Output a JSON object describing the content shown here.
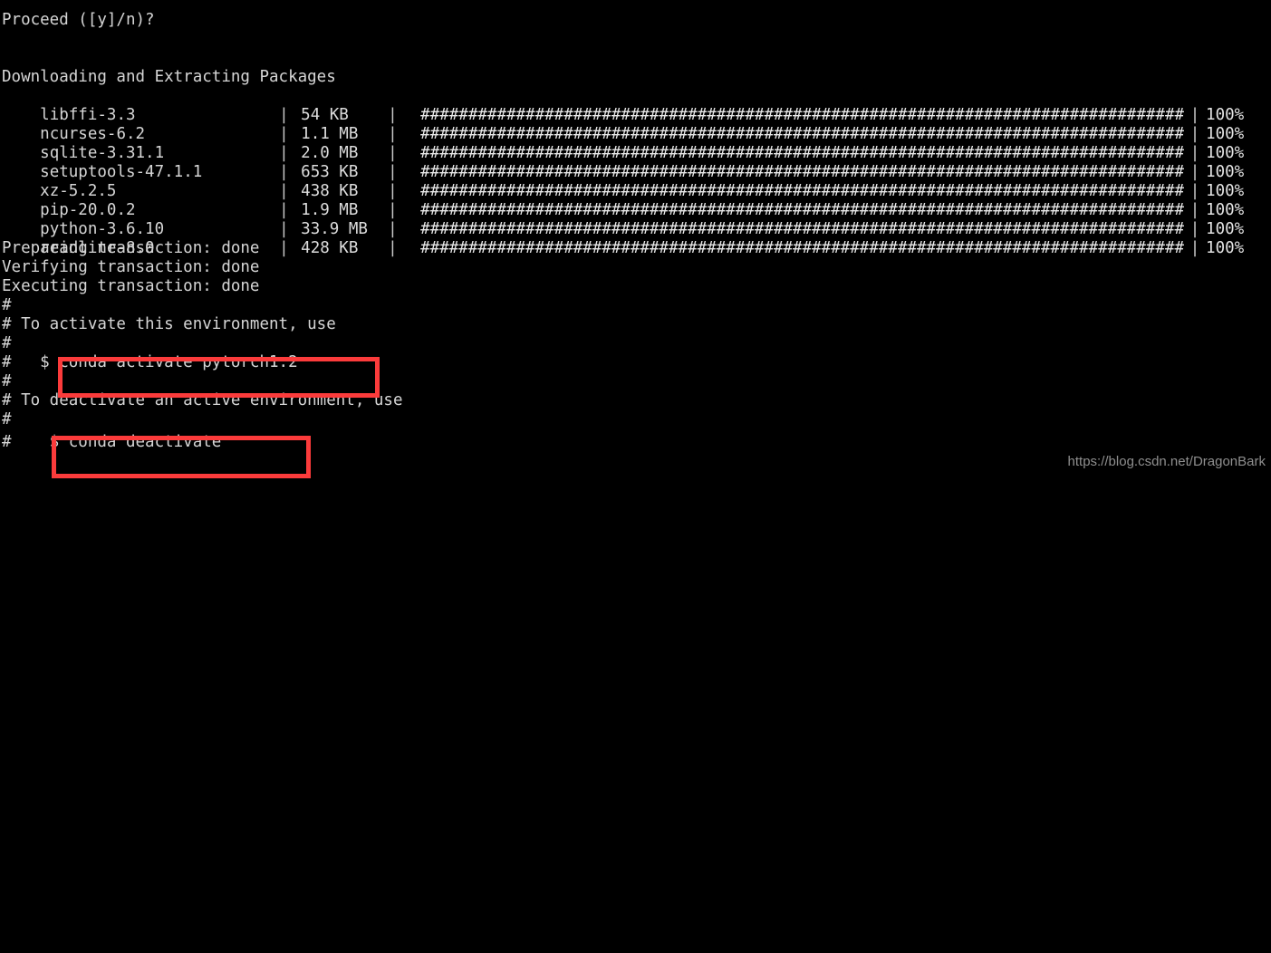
{
  "terminal": {
    "prompt_line": "Proceed ([y]/n)?",
    "blank_1": "",
    "blank_2": "",
    "section_header": "Downloading and Extracting Packages",
    "packages": [
      {
        "name": "libffi-3.3",
        "size": "54 KB",
        "bar": "################################################################################",
        "percent": "100%"
      },
      {
        "name": "ncurses-6.2",
        "size": "1.1 MB",
        "bar": "################################################################################",
        "percent": "100%"
      },
      {
        "name": "sqlite-3.31.1",
        "size": "2.0 MB",
        "bar": "################################################################################",
        "percent": "100%"
      },
      {
        "name": "setuptools-47.1.1",
        "size": "653 KB",
        "bar": "################################################################################",
        "percent": "100%"
      },
      {
        "name": "xz-5.2.5",
        "size": "438 KB",
        "bar": "################################################################################",
        "percent": "100%"
      },
      {
        "name": "pip-20.0.2",
        "size": "1.9 MB",
        "bar": "################################################################################",
        "percent": "100%"
      },
      {
        "name": "python-3.6.10",
        "size": "33.9 MB",
        "bar": "################################################################################",
        "percent": "100%"
      },
      {
        "name": "readline-8.0",
        "size": "428 KB",
        "bar": "################################################################################",
        "percent": "100%"
      }
    ],
    "separator": "|",
    "preparing_line": "Preparing transaction: done",
    "verifying_line": "Verifying transaction: done",
    "executing_line": "Executing transaction: done",
    "hash_1": "#",
    "activate_hint": "# To activate this environment, use",
    "hash_2": "#",
    "activate_command": "#   $ conda activate pytorch1.2",
    "hash_3": "#",
    "deactivate_hint": "# To deactivate an active environment, use",
    "hash_4": "#",
    "deactivate_command": "#    $ conda deactivate"
  },
  "highlights": {
    "color": "#fb3b3b",
    "activate_box_label": "conda activate pytorch1.2",
    "deactivate_box_label": "conda deactivate"
  },
  "watermark": {
    "text": "https://blog.csdn.net/DragonBark",
    "color": "#8f8f8f"
  }
}
